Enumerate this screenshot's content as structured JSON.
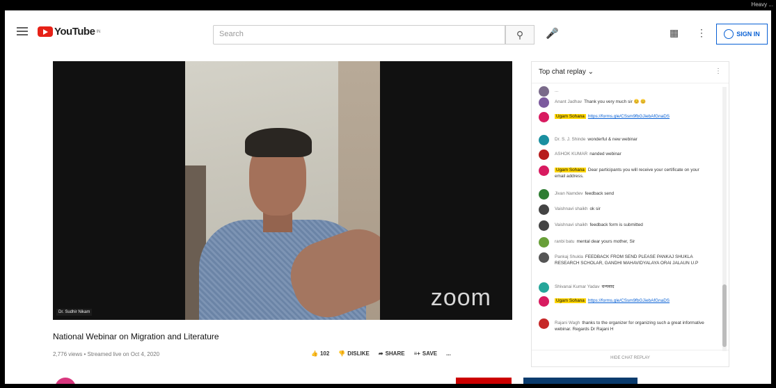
{
  "top_strip": {
    "hint": "Heavy ..."
  },
  "header": {
    "logo_text": "YouTube",
    "logo_region": "IN",
    "search_placeholder": "Search",
    "sign_in_label": "SIGN IN"
  },
  "video": {
    "watermark": "zoom",
    "speaker_name": "Dr. Sudhir Nikam"
  },
  "info": {
    "title": "National Webinar on Migration and Literature",
    "meta": "2,776 views • Streamed live on Oct 4, 2020",
    "likes": "102",
    "dislike_label": "DISLIKE",
    "share_label": "SHARE",
    "save_label": "SAVE",
    "more_label": "..."
  },
  "chat": {
    "header_title": "Top chat replay",
    "footer": "HIDE CHAT REPLAY",
    "messages": [
      {
        "author": "...",
        "text": "",
        "color": "#7a6a8a",
        "highlight": false,
        "link": false
      },
      {
        "author": "Anant Jadhav",
        "text": "Thank you very much sir 😊 😊",
        "color": "#7c5a9e",
        "highlight": false,
        "link": false
      },
      {
        "author": "Ugam Sohana",
        "text": "https://forms.gle/CSsm9fbGJiebAfGnaDS",
        "color": "#d81b60",
        "highlight": true,
        "link": true
      },
      {
        "author": "Dr. S. J. Shinde",
        "text": "wonderful & new webinar",
        "color": "#1a8fa0",
        "highlight": false,
        "link": false
      },
      {
        "author": "ASHOK KUMAR",
        "text": "nanded webinar",
        "color": "#b71c1c",
        "highlight": false,
        "link": false
      },
      {
        "author": "Ugam Sohana",
        "text": "Dear participants you will receive your certificate on your email address.",
        "color": "#d81b60",
        "highlight": true,
        "link": false
      },
      {
        "author": "Jivan Namdev",
        "text": "feedback send",
        "color": "#2e7d32",
        "highlight": false,
        "link": false
      },
      {
        "author": "Vaishnavi shaikh",
        "text": "ok sir",
        "color": "#444",
        "highlight": false,
        "link": false
      },
      {
        "author": "Vaishnavi shaikh",
        "text": "feedback form is submitted",
        "color": "#444",
        "highlight": false,
        "link": false
      },
      {
        "author": "ranbi batu",
        "text": "mental dear yours mother, Sir",
        "color": "#689f38",
        "highlight": false,
        "link": false
      },
      {
        "author": "Pankaj Shukla",
        "text": "FEEDBACK FROM SEND PLEASE PANKAJ SHUKLA RESEARCH SCHOLAR, GANDHI MAHAVIDYALAYA ORAI JALAUN U.P",
        "color": "#555",
        "highlight": false,
        "link": false
      },
      {
        "author": "Shivanai Kumar Yadav",
        "text": "धन्यवाद",
        "color": "#26a69a",
        "highlight": false,
        "link": false
      },
      {
        "author": "Ugam Sohana",
        "text": "https://forms.gle/CSsm9fbGJiebAfGnaDS",
        "color": "#d81b60",
        "highlight": true,
        "link": true
      },
      {
        "author": "Rajani Wagh",
        "text": "thanks to the organizer for organizing such a great informative webinar. Regards Dr Rajani H",
        "color": "#c62828",
        "highlight": false,
        "link": false
      }
    ]
  }
}
